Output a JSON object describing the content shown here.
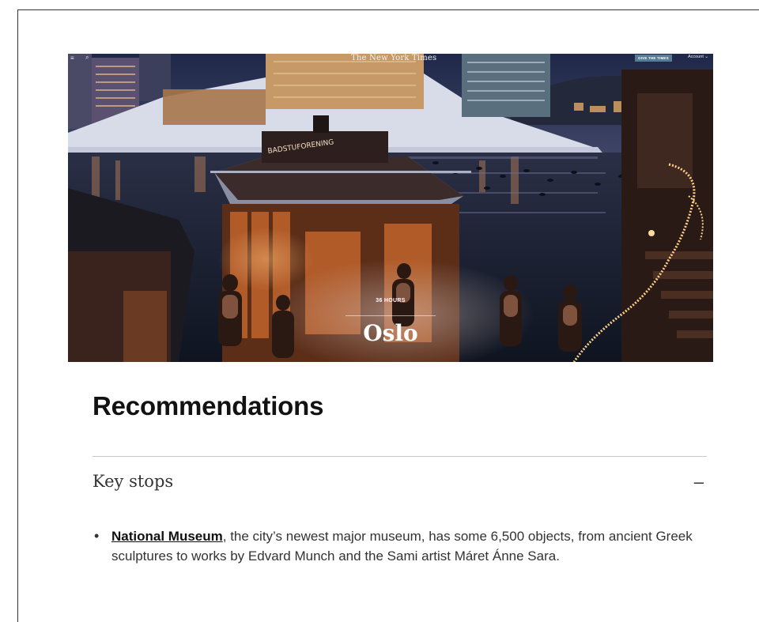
{
  "hero": {
    "topbar": {
      "menu_icon": "hamburger-icon",
      "search_icon": "search-icon",
      "logo": "The New York Times",
      "give_button": "GIVE THE TIMES",
      "account_label": "Account"
    },
    "sign_text": "BADSTUFORENING",
    "kicker": "36 HOURS",
    "title": "Oslo"
  },
  "content": {
    "heading": "Recommendations",
    "section": {
      "title": "Key stops",
      "toggle": "–"
    },
    "items": [
      {
        "link": "National Museum",
        "text": ", the city’s newest major museum, has some 6,500 objects, from ancient Greek sculptures to works by Edvard Munch and the Sami artist Máret Ánne Sara."
      }
    ]
  },
  "colors": {
    "give_button_bg": "#567b95",
    "heading": "#121212",
    "body_text": "#333333"
  }
}
